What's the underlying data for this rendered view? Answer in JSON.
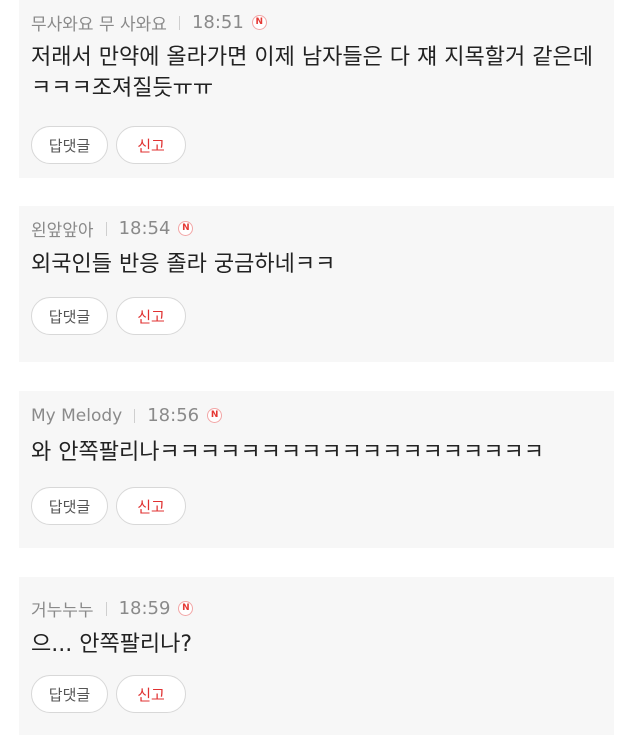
{
  "comments": [
    {
      "author": "무사와요 무 사와요",
      "time": "18:51",
      "new_badge": "N",
      "body": "저래서 만약에 올라가면 이제 남자들은 다 쟤 지목할거 같은데ㅋㅋㅋ조져질듯ㅠㅠ",
      "reply_label": "답댓글",
      "report_label": "신고"
    },
    {
      "author": "왼앞앞아",
      "time": "18:54",
      "new_badge": "N",
      "body": "외국인들 반응 졸라 궁금하네ㅋㅋ",
      "reply_label": "답댓글",
      "report_label": "신고"
    },
    {
      "author": "My Melody",
      "time": "18:56",
      "new_badge": "N",
      "body": "와 안쪽팔리나ㅋㅋㅋㅋㅋㅋㅋㅋㅋㅋㅋㅋㅋㅋㅋㅋㅋㅋㅋ",
      "reply_label": "답댓글",
      "report_label": "신고"
    },
    {
      "author": "거누누누",
      "time": "18:59",
      "new_badge": "N",
      "body": "으... 안쪽팔리나?",
      "reply_label": "답댓글",
      "report_label": "신고"
    }
  ],
  "colors": {
    "card_bg": "#f7f7f7",
    "meta_text": "#8a8a8a",
    "body_text": "#222222",
    "report_red": "#e03131",
    "badge_red": "#e53935"
  }
}
